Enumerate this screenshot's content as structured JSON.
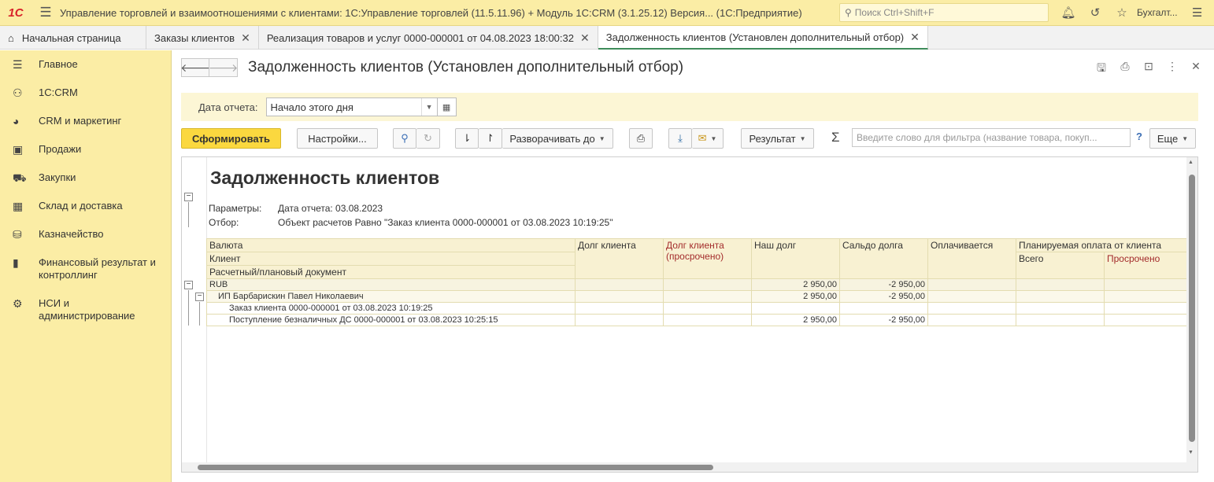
{
  "titlebar": {
    "logo": "1С",
    "title": "Управление торговлей и взаимоотношениями с клиентами: 1С:Управление торговлей (11.5.11.96) + Модуль 1С:CRM (3.1.25.12) Версия...  (1С:Предприятие)",
    "search_placeholder": "Поиск Ctrl+Shift+F",
    "user": "Бухгалт..."
  },
  "tabs": [
    {
      "label": "Начальная страница"
    },
    {
      "label": "Заказы клиентов"
    },
    {
      "label": "Реализация товаров и услуг 0000-000001 от 04.08.2023 18:00:32"
    },
    {
      "label": "Задолженность клиентов (Установлен дополнительный отбор)"
    }
  ],
  "sidebar": {
    "items": [
      {
        "label": "Главное",
        "icon": "menu-icon"
      },
      {
        "label": "1С:CRM",
        "icon": "crm-icon"
      },
      {
        "label": "CRM и маркетинг",
        "icon": "pie-icon"
      },
      {
        "label": "Продажи",
        "icon": "bag-icon"
      },
      {
        "label": "Закупки",
        "icon": "cart-icon"
      },
      {
        "label": "Склад и доставка",
        "icon": "grid-icon"
      },
      {
        "label": "Казначейство",
        "icon": "coins-icon"
      },
      {
        "label": "Финансовый результат и контроллинг",
        "icon": "bar-chart-icon"
      },
      {
        "label": "НСИ и администрирование",
        "icon": "gear-icon"
      }
    ]
  },
  "form": {
    "title": "Задолженность клиентов (Установлен дополнительный отбор)",
    "date_label": "Дата отчета:",
    "date_value": "Начало этого дня"
  },
  "toolbar": {
    "generate": "Сформировать",
    "settings": "Настройки...",
    "expand_to": "Разворачивать до",
    "result": "Результат",
    "filter_placeholder": "Введите слово для фильтра (название товара, покуп...",
    "help": "?",
    "more": "Еще"
  },
  "report": {
    "title": "Задолженность клиентов",
    "params_label": "Параметры:",
    "params_value": "Дата отчета: 03.08.2023",
    "filter_label": "Отбор:",
    "filter_value": "Объект расчетов Равно \"Заказ клиента 0000-000001 от 03.08.2023 10:19:25\"",
    "headers": {
      "currency": "Валюта",
      "client": "Клиент",
      "doc": "Расчетный/плановый документ",
      "client_debt": "Долг клиента",
      "client_debt_overdue": "Долг клиента (просрочено)",
      "our_debt": "Наш долг",
      "balance": "Сальдо долга",
      "paying": "Оплачивается",
      "planned": "Планируемая оплата от клиента",
      "planned_total": "Всего",
      "planned_overdue": "Просрочено"
    },
    "rows": [
      {
        "label": "RUB",
        "client_debt": "",
        "overdue": "",
        "our_debt": "2 950,00",
        "balance": "-2 950,00"
      },
      {
        "label": "ИП Барбарискин Павел Николаевич",
        "client_debt": "",
        "overdue": "",
        "our_debt": "2 950,00",
        "balance": "-2 950,00"
      },
      {
        "label": "Заказ клиента 0000-000001 от 03.08.2023 10:19:25",
        "client_debt": "",
        "overdue": "",
        "our_debt": "",
        "balance": ""
      },
      {
        "label": "Поступление безналичных ДС 0000-000001 от 03.08.2023 10:25:15",
        "client_debt": "",
        "overdue": "",
        "our_debt": "2 950,00",
        "balance": "-2 950,00"
      }
    ]
  }
}
